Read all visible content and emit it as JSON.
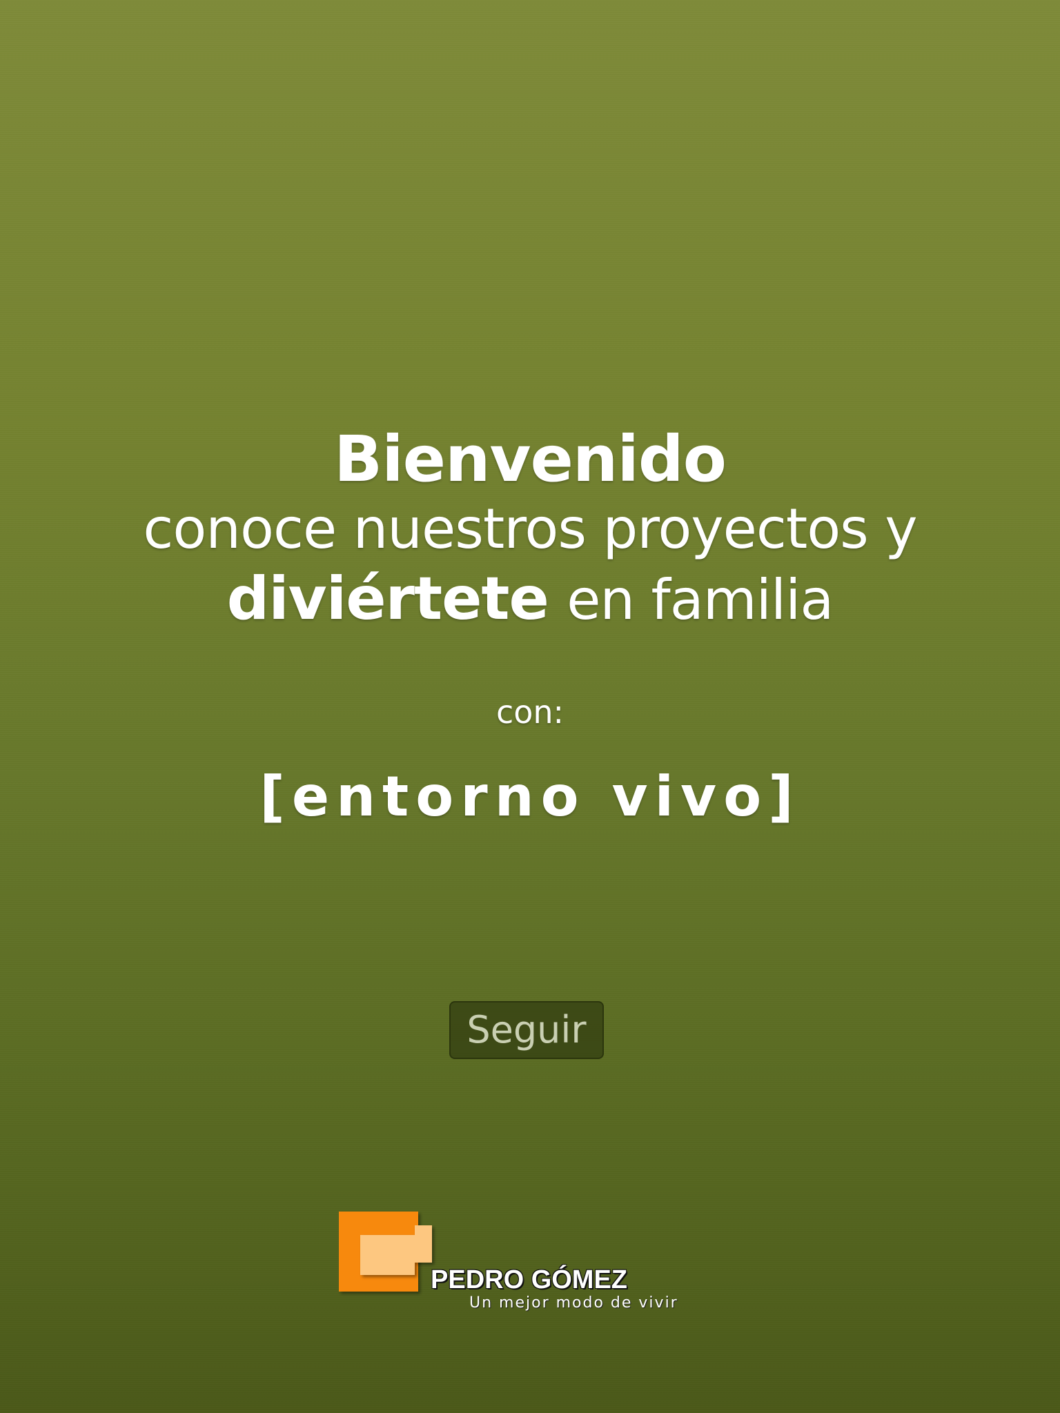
{
  "welcome": {
    "title": "Bienvenido",
    "line2": "conoce nuestros proyectos y",
    "line3_strong": "diviértete",
    "line3_light": "en familia",
    "con_label": "con:",
    "tagline": "[entorno vivo]"
  },
  "actions": {
    "continue_label": "Seguir"
  },
  "brand": {
    "name": "PEDRO GÓMEZ",
    "slogan": "Un mejor modo de vivir",
    "logo_icon": "pedro-gomez-logo-icon"
  },
  "colors": {
    "background_top": "#7e8a38",
    "background_bottom": "#4a5818",
    "text": "#ffffff",
    "button_bg": "#344012",
    "button_text": "#c9cfb2",
    "logo_orange": "#f7890a",
    "logo_peach": "#fdc780"
  }
}
